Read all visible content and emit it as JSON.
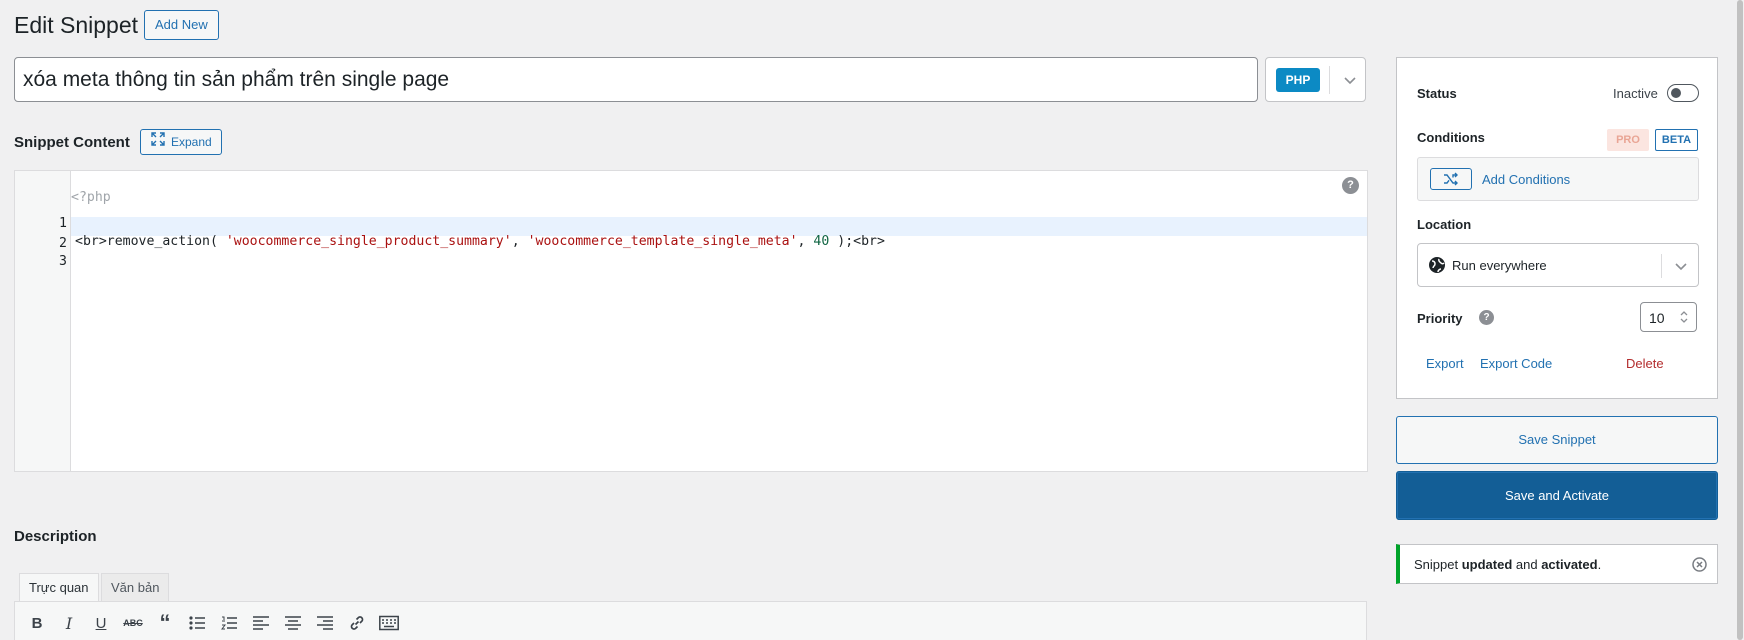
{
  "header": {
    "title": "Edit Snippet",
    "add_new_label": "Add New"
  },
  "snippet": {
    "title": "xóa meta thông tin sản phẩm trên single page",
    "language": "PHP"
  },
  "content": {
    "label": "Snippet Content",
    "expand_label": "Expand",
    "open_tag": "<?php",
    "lines": [
      {
        "number": "1"
      },
      {
        "number": "2",
        "code": ""
      },
      {
        "number": "3",
        "code": ""
      }
    ],
    "line1": {
      "prefix": "<br>remove_action( ",
      "arg1": "'woocommerce_single_product_summary'",
      "sep1": ", ",
      "arg2": "'woocommerce_template_single_meta'",
      "sep2": ", ",
      "arg3": "40",
      "suffix": " );<br>"
    },
    "help": "?"
  },
  "description": {
    "label": "Description",
    "tabs": [
      "Trực quan",
      "Văn bản"
    ],
    "toolbar": [
      "bold-icon",
      "italic-icon",
      "underline-icon",
      "strikethrough-icon",
      "blockquote-icon",
      "bullet-list-icon",
      "numbered-list-icon",
      "align-left-icon",
      "align-center-icon",
      "align-right-icon",
      "link-icon",
      "keyboard-icon"
    ]
  },
  "sidebar": {
    "status_label": "Status",
    "status_value": "Inactive",
    "status_active": false,
    "conditions_label": "Conditions",
    "pro_badge": "PRO",
    "beta_badge": "BETA",
    "add_conditions_label": "Add Conditions",
    "location_label": "Location",
    "location_value": "Run everywhere",
    "priority_label": "Priority",
    "priority_help": "?",
    "priority_value": "10",
    "export_label": "Export",
    "export_code_label": "Export Code",
    "delete_label": "Delete"
  },
  "actions": {
    "save_label": "Save Snippet",
    "save_activate_label": "Save and Activate"
  },
  "notice": {
    "prefix": "Snippet ",
    "strong1": "updated",
    "middle": " and ",
    "strong2": "activated",
    "suffix": "."
  },
  "colors": {
    "accent": "#2271b1",
    "primary_button": "#135e96",
    "php_badge": "#0c8ac4",
    "success": "#00a32a",
    "danger": "#b32d2e"
  }
}
